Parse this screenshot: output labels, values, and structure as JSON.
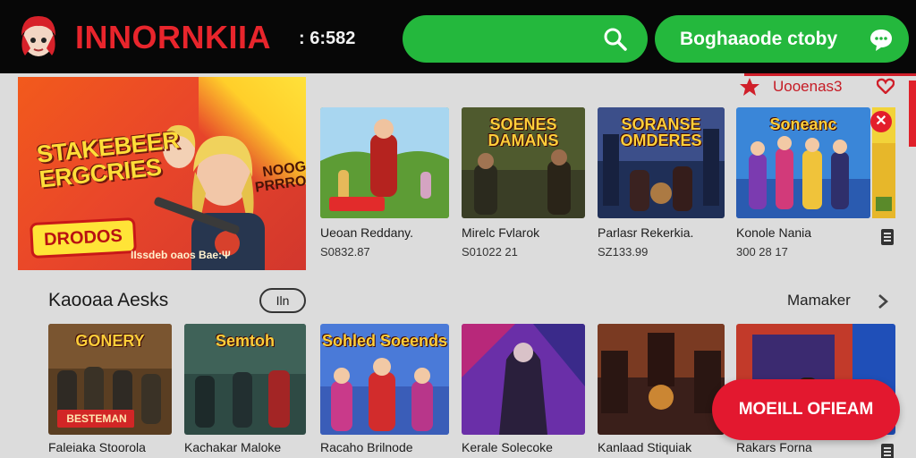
{
  "header": {
    "brand": "INNORNKIIA",
    "time": ": 6:582",
    "search_icon": "search-icon",
    "cta_label": "Boghaaode ctoby",
    "cta_icon": "chat-bubble-icon"
  },
  "notification": {
    "text": "Uooenas3",
    "star_icon": "star-icon",
    "heart_icon": "heart-icon"
  },
  "hero": {
    "title": "STAKEBEER ERGCRIES",
    "tag": "NOOG PRRROO",
    "badge": "DRODOS",
    "caption": "IIssdeb  oaos Bae:Ψ"
  },
  "row1": [
    {
      "thumb_title": "",
      "name": "Ueoan Reddany.",
      "meta": "S0832.87"
    },
    {
      "thumb_title": "SOENES DAMANS",
      "name": "Mirelc Fvlarok",
      "meta": "S01022 21"
    },
    {
      "thumb_title": "SORANSE OMDERES",
      "name": "Parlasr Rekerkia.",
      "meta": "SZ133.99"
    },
    {
      "thumb_title": "Soneanc",
      "name": "Konole Nania",
      "meta": "300 28 17"
    }
  ],
  "section": {
    "title": "Kaooaa Aesks",
    "pill": "Iln",
    "more": "Mamaker"
  },
  "row2": [
    {
      "thumb_title": "GONERY",
      "tag": "BESTEMAN",
      "name": "Faleiaka Stoorola"
    },
    {
      "thumb_title": "Semtoh",
      "name": "Kachakar Maloke"
    },
    {
      "thumb_title": "Sohled Soeends",
      "name": "Racaho Brilnode"
    },
    {
      "thumb_title": "",
      "name": "Kerale Solecoke"
    },
    {
      "thumb_title": "",
      "name": "Kanlaad Stiquiak"
    },
    {
      "thumb_title": "",
      "name": "Rakars Forna"
    }
  ],
  "floating_button": "MOEILL OFIEAM",
  "colors": {
    "header_bg": "#070707",
    "brand_red": "#e8252c",
    "accent_green": "#24b83d",
    "cta_red": "#e3182f",
    "page_bg": "#dcdcdc"
  }
}
